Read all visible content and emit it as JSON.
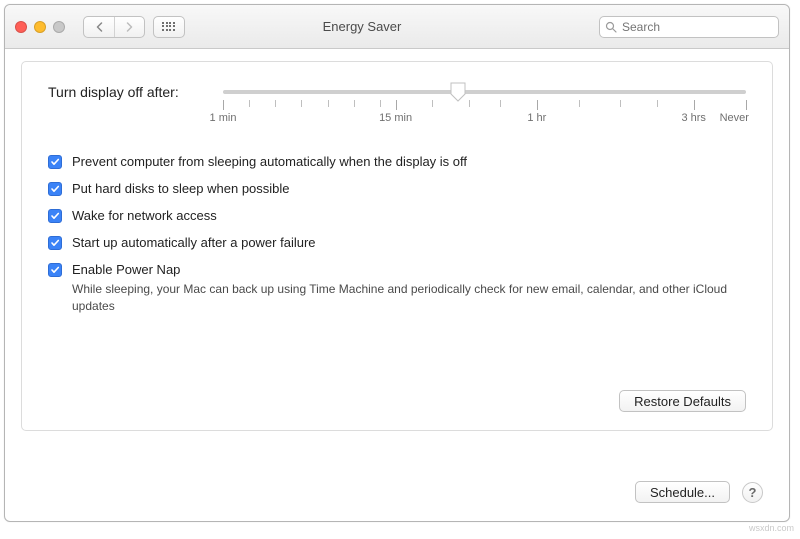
{
  "window": {
    "title": "Energy Saver"
  },
  "search": {
    "placeholder": "Search",
    "value": ""
  },
  "slider": {
    "label": "Turn display off after:",
    "value_percent": 45,
    "tick_labels": {
      "p0": "1 min",
      "p33": "15 min",
      "p60": "1 hr",
      "p90": "3 hrs",
      "p100": "Never"
    }
  },
  "checks": {
    "prevent_sleep": {
      "checked": true,
      "label": "Prevent computer from sleeping automatically when the display is off"
    },
    "hd_sleep": {
      "checked": true,
      "label": "Put hard disks to sleep when possible"
    },
    "wake_net": {
      "checked": true,
      "label": "Wake for network access"
    },
    "auto_start": {
      "checked": true,
      "label": "Start up automatically after a power failure"
    },
    "power_nap": {
      "checked": true,
      "label": "Enable Power Nap",
      "desc": "While sleeping, your Mac can back up using Time Machine and periodically check for new email, calendar, and other iCloud updates"
    }
  },
  "buttons": {
    "restore": "Restore Defaults",
    "schedule": "Schedule...",
    "help": "?"
  },
  "watermark": "wsxdn.com"
}
